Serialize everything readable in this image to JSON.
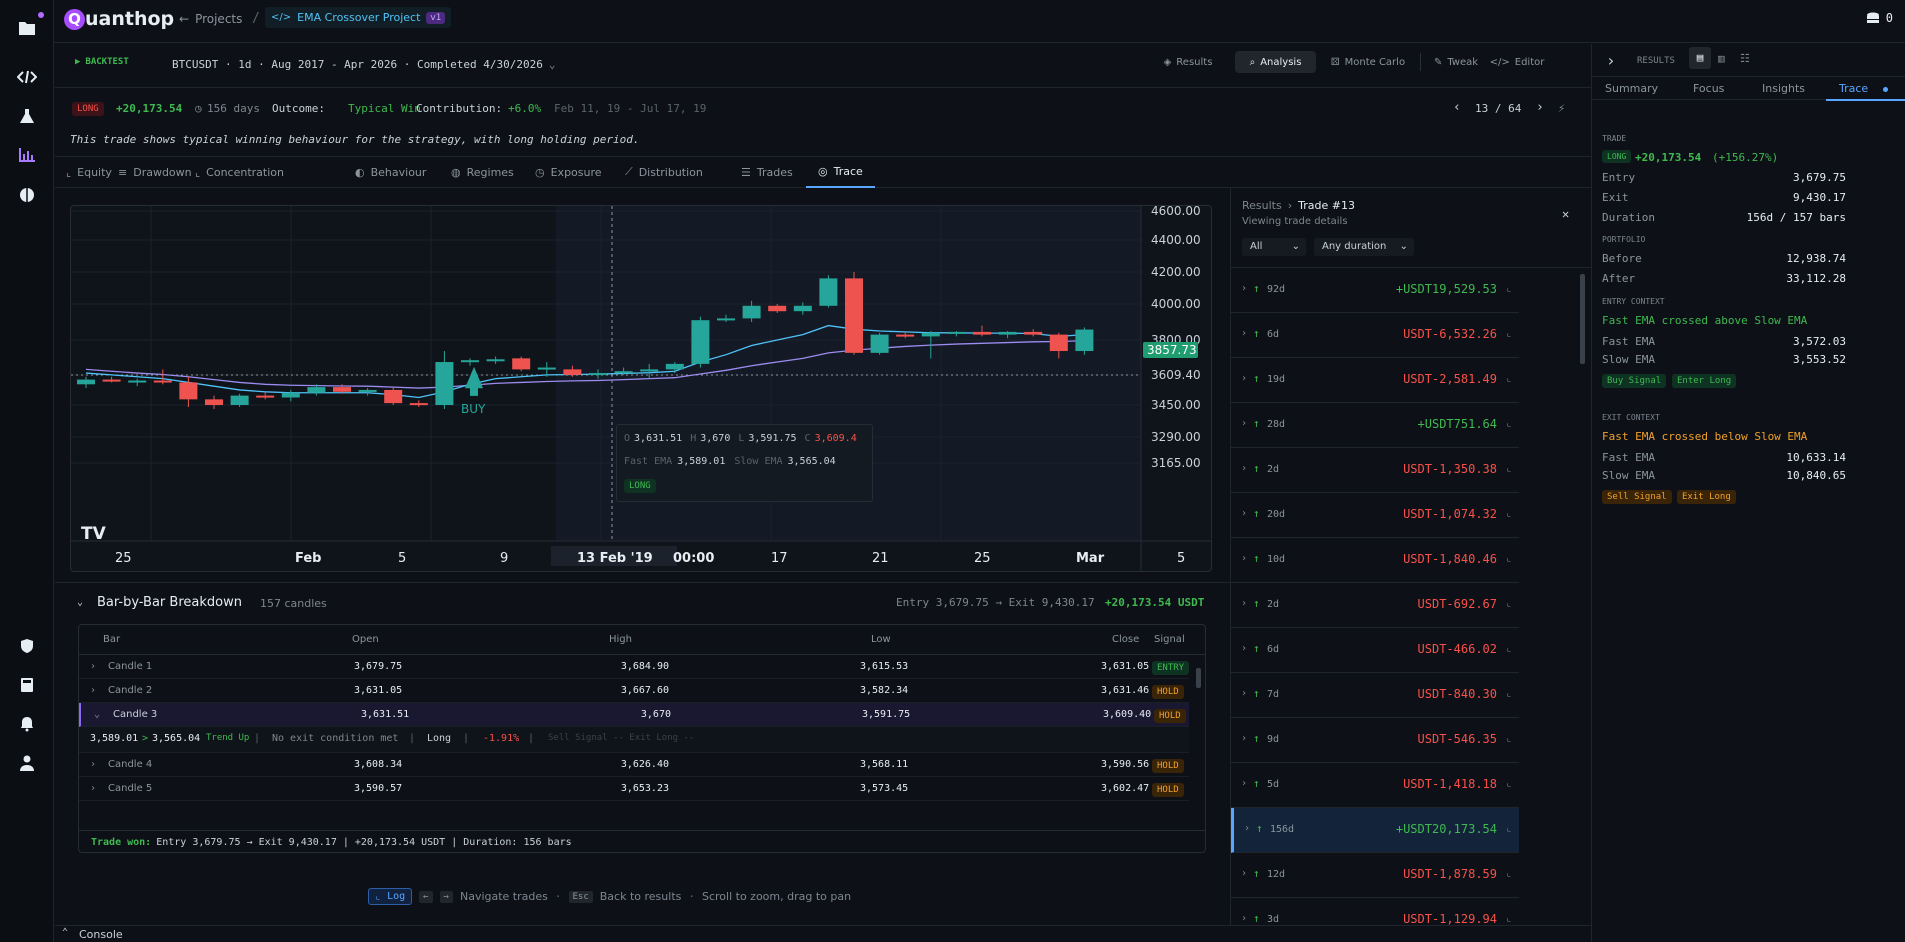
{
  "app": {
    "brand": "uanthop",
    "brand_q": "Q",
    "back_label": "Projects",
    "project_name": "EMA Crossover Project",
    "version": "v1",
    "credits": "0"
  },
  "run_bar": {
    "mode": "BACKTEST",
    "summary": "BTCUSDT · 1d · Aug 2017 - Apr 2026 · Completed 4/30/2026",
    "buttons": [
      "Results",
      "Analysis",
      "Monte Carlo",
      "Tweak",
      "Editor"
    ],
    "active_button": "Analysis"
  },
  "trade_header": {
    "side": "LONG",
    "pnl": "+20,173.54",
    "days": "156 days",
    "outcome_label": "Outcome:",
    "outcome": "Typical Win",
    "contribution_label": "Contribution:",
    "contribution": "+6.0%",
    "dates": "Feb 11, 19 - Jul 17, 19",
    "pager": "13 / 64",
    "description": "This trade shows typical winning behaviour for the strategy, with long holding period."
  },
  "analysis_tabs": [
    "Equity",
    "Drawdown",
    "Concentration",
    "Behaviour",
    "Regimes",
    "Exposure",
    "Distribution",
    "Trades",
    "Trace"
  ],
  "active_analysis_tab": "Trace",
  "chart_data": {
    "type": "candlestick",
    "y_ticks": [
      "4600.00",
      "4400.00",
      "4200.00",
      "4000.00",
      "3800.00",
      "3609.40",
      "3450.00",
      "3290.00",
      "3165.00"
    ],
    "x_ticks": [
      "25",
      "Feb",
      "5",
      "9",
      "13 Feb '19",
      "00:00",
      "17",
      "21",
      "25",
      "Mar",
      "5"
    ],
    "last_price": "3857.73",
    "marker_label": "BUY",
    "tooltip": {
      "o_label": "O",
      "o": "3,631.51",
      "h_label": "H",
      "h": "3,670",
      "l_label": "L",
      "l": "3,591.75",
      "c_label": "C",
      "c": "3,609.4",
      "fast_label": "Fast EMA",
      "fast": "3,589.01",
      "slow_label": "Slow EMA",
      "slow": "3,565.04",
      "badge": "LONG"
    },
    "candles": [
      [
        3560,
        3600,
        3540,
        3585
      ],
      [
        3585,
        3600,
        3570,
        3575
      ],
      [
        3575,
        3590,
        3550,
        3580
      ],
      [
        3580,
        3640,
        3560,
        3570
      ],
      [
        3570,
        3600,
        3440,
        3480
      ],
      [
        3480,
        3500,
        3430,
        3450
      ],
      [
        3450,
        3510,
        3440,
        3500
      ],
      [
        3500,
        3520,
        3480,
        3490
      ],
      [
        3490,
        3530,
        3470,
        3515
      ],
      [
        3515,
        3560,
        3500,
        3545
      ],
      [
        3545,
        3560,
        3510,
        3520
      ],
      [
        3520,
        3540,
        3500,
        3530
      ],
      [
        3530,
        3545,
        3450,
        3460
      ],
      [
        3460,
        3475,
        3440,
        3450
      ],
      [
        3450,
        3740,
        3430,
        3680
      ],
      [
        3680,
        3700,
        3660,
        3690
      ],
      [
        3690,
        3710,
        3670,
        3695
      ],
      [
        3700,
        3710,
        3630,
        3640
      ],
      [
        3640,
        3680,
        3600,
        3650
      ],
      [
        3640,
        3660,
        3600,
        3610
      ],
      [
        3610,
        3640,
        3590,
        3620
      ],
      [
        3620,
        3650,
        3610,
        3630
      ],
      [
        3630,
        3670,
        3591,
        3640
      ],
      [
        3640,
        3680,
        3620,
        3670
      ],
      [
        3670,
        3930,
        3650,
        3910
      ],
      [
        3910,
        3940,
        3900,
        3920
      ],
      [
        3920,
        4020,
        3900,
        3990
      ],
      [
        3990,
        4000,
        3950,
        3960
      ],
      [
        3960,
        4010,
        3940,
        3990
      ],
      [
        3990,
        4180,
        3980,
        4160
      ],
      [
        4160,
        4200,
        3720,
        3730
      ],
      [
        3730,
        3840,
        3720,
        3830
      ],
      [
        3830,
        3850,
        3810,
        3820
      ],
      [
        3820,
        3850,
        3700,
        3840
      ],
      [
        3840,
        3850,
        3820,
        3845
      ],
      [
        3845,
        3880,
        3820,
        3830
      ],
      [
        3830,
        3850,
        3810,
        3845
      ],
      [
        3845,
        3860,
        3820,
        3830
      ],
      [
        3830,
        3840,
        3700,
        3740
      ],
      [
        3740,
        3870,
        3720,
        3858
      ]
    ],
    "fast_ema": [
      3620,
      3610,
      3600,
      3590,
      3570,
      3550,
      3530,
      3520,
      3515,
      3515,
      3515,
      3515,
      3505,
      3490,
      3520,
      3560,
      3590,
      3600,
      3610,
      3612,
      3614,
      3618,
      3622,
      3630,
      3680,
      3720,
      3770,
      3800,
      3830,
      3880,
      3860,
      3850,
      3845,
      3840,
      3840,
      3838,
      3838,
      3836,
      3820,
      3830
    ],
    "slow_ema": [
      3640,
      3630,
      3620,
      3612,
      3600,
      3585,
      3570,
      3560,
      3555,
      3553,
      3551,
      3550,
      3545,
      3540,
      3545,
      3555,
      3565,
      3570,
      3575,
      3578,
      3580,
      3585,
      3590,
      3595,
      3615,
      3635,
      3660,
      3680,
      3700,
      3730,
      3745,
      3755,
      3765,
      3772,
      3778,
      3782,
      3786,
      3790,
      3792,
      3796
    ]
  },
  "breakdown": {
    "title": "Bar-by-Bar Breakdown",
    "count": "157 candles",
    "summary_left": "Entry 3,679.75 → Exit 9,430.17",
    "summary_pnl": "+20,173.54 USDT",
    "columns": [
      "Bar",
      "Open",
      "High",
      "Low",
      "Close",
      "Signal"
    ],
    "rows": [
      {
        "bar": "Candle 1",
        "open": "3,679.75",
        "high": "3,684.90",
        "low": "3,615.53",
        "close": "3,631.05",
        "signal": "ENTRY"
      },
      {
        "bar": "Candle 2",
        "open": "3,631.05",
        "high": "3,667.60",
        "low": "3,582.34",
        "close": "3,631.46",
        "signal": "HOLD"
      },
      {
        "bar": "Candle 3",
        "open": "3,631.51",
        "high": "3,670",
        "low": "3,591.75",
        "close": "3,609.40",
        "signal": "HOLD"
      },
      {
        "bar": "Candle 4",
        "open": "3,608.34",
        "high": "3,626.40",
        "low": "3,568.11",
        "close": "3,590.56",
        "signal": "HOLD"
      },
      {
        "bar": "Candle 5",
        "open": "3,590.57",
        "high": "3,653.23",
        "low": "3,573.45",
        "close": "3,602.47",
        "signal": "HOLD"
      }
    ],
    "detail": {
      "fast": "3,589.01",
      "slow": "3,565.04",
      "trend": "Trend Up",
      "exit": "No exit condition met",
      "side": "Long",
      "change": "-1.91%",
      "signals": "Sell Signal -- Exit Long --"
    },
    "footer_label": "Trade won:",
    "footer_text": "Entry 3,679.75 → Exit 9,430.17 | +20,173.54 USDT | Duration: 156 bars"
  },
  "hints": {
    "log": "Log",
    "nav": "Navigate trades",
    "esc": "Esc",
    "back": "Back to results",
    "scroll": "Scroll to zoom, drag to pan"
  },
  "trades_panel": {
    "breadcrumb_root": "Results",
    "breadcrumb_current": "Trade #13",
    "subtitle": "Viewing trade details",
    "filter_side": "All",
    "filter_duration": "Any duration",
    "rows": [
      {
        "dur": "92d",
        "pnl": "+USDT19,529.53",
        "pos": true
      },
      {
        "dur": "6d",
        "pnl": "USDT-6,532.26",
        "pos": false
      },
      {
        "dur": "19d",
        "pnl": "USDT-2,581.49",
        "pos": false
      },
      {
        "dur": "28d",
        "pnl": "+USDT751.64",
        "pos": true
      },
      {
        "dur": "2d",
        "pnl": "USDT-1,350.38",
        "pos": false
      },
      {
        "dur": "20d",
        "pnl": "USDT-1,074.32",
        "pos": false
      },
      {
        "dur": "10d",
        "pnl": "USDT-1,840.46",
        "pos": false
      },
      {
        "dur": "2d",
        "pnl": "USDT-692.67",
        "pos": false
      },
      {
        "dur": "6d",
        "pnl": "USDT-466.02",
        "pos": false
      },
      {
        "dur": "7d",
        "pnl": "USDT-840.30",
        "pos": false
      },
      {
        "dur": "9d",
        "pnl": "USDT-546.35",
        "pos": false
      },
      {
        "dur": "5d",
        "pnl": "USDT-1,418.18",
        "pos": false
      },
      {
        "dur": "156d",
        "pnl": "+USDT20,173.54",
        "pos": true,
        "selected": true
      },
      {
        "dur": "12d",
        "pnl": "USDT-1,878.59",
        "pos": false
      },
      {
        "dur": "3d",
        "pnl": "USDT-1,129.94",
        "pos": false
      }
    ]
  },
  "results_panel": {
    "title": "RESULTS",
    "tabs": [
      "Summary",
      "Focus",
      "Insights",
      "Trace"
    ],
    "active_tab": "Trace",
    "trade_heading": "TRADE",
    "side": "LONG",
    "pnl": "+20,173.54",
    "pnl_pct": "(+156.27%)",
    "entry_label": "Entry",
    "entry": "3,679.75",
    "exit_label": "Exit",
    "exit": "9,430.17",
    "duration_label": "Duration",
    "duration": "156d / 157 bars",
    "portfolio_heading": "PORTFOLIO",
    "before_label": "Before",
    "before": "12,938.74",
    "after_label": "After",
    "after": "33,112.28",
    "entry_ctx_heading": "ENTRY CONTEXT",
    "entry_ctx_text": "Fast EMA crossed above Slow EMA",
    "entry_fast_label": "Fast EMA",
    "entry_fast": "3,572.03",
    "entry_slow_label": "Slow EMA",
    "entry_slow": "3,553.52",
    "entry_tags": [
      "Buy Signal",
      "Enter Long"
    ],
    "exit_ctx_heading": "EXIT CONTEXT",
    "exit_ctx_text": "Fast EMA crossed below Slow EMA",
    "exit_fast_label": "Fast EMA",
    "exit_fast": "10,633.14",
    "exit_slow_label": "Slow EMA",
    "exit_slow": "10,840.65",
    "exit_tags": [
      "Sell Signal",
      "Exit Long"
    ]
  },
  "console": {
    "label": "Console"
  },
  "colors": {
    "up": "#26a69a",
    "down": "#ef5350",
    "fast_ema": "#4fc3f7",
    "slow_ema": "#9c8cf0",
    "accent": "#58a6ff"
  }
}
